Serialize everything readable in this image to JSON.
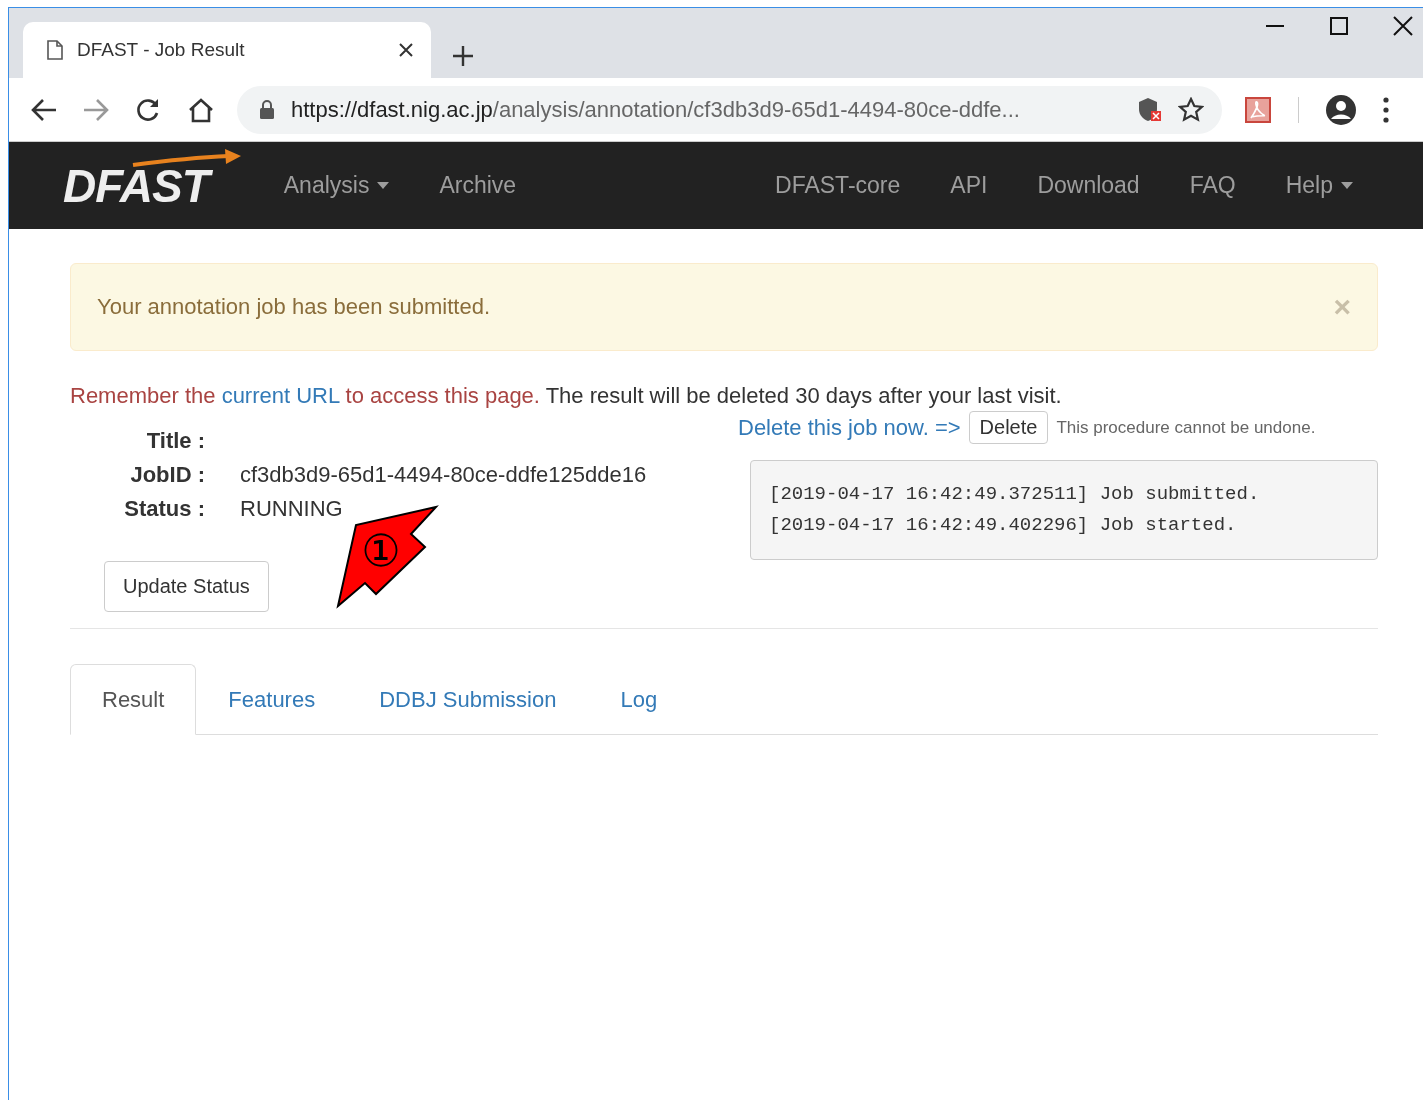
{
  "browser": {
    "tab_title": "DFAST - Job Result",
    "url_host": "https://dfast.nig.ac.jp",
    "url_path": "/analysis/annotation/cf3db3d9-65d1-4494-80ce-ddfe..."
  },
  "navbar": {
    "logo": "DFAST",
    "left_items": [
      {
        "label": "Analysis",
        "dropdown": true
      },
      {
        "label": "Archive",
        "dropdown": false
      }
    ],
    "right_items": [
      {
        "label": "DFAST-core",
        "dropdown": false
      },
      {
        "label": "API",
        "dropdown": false
      },
      {
        "label": "Download",
        "dropdown": false
      },
      {
        "label": "FAQ",
        "dropdown": false
      },
      {
        "label": "Help",
        "dropdown": true
      }
    ]
  },
  "alert": {
    "message": "Your annotation job has been submitted.",
    "close": "×"
  },
  "notice": {
    "before": "Remember the",
    "link": "current URL",
    "after": "to access this page.",
    "rest": "The result will be deleted 30 days after your last visit."
  },
  "delete": {
    "prompt": "Delete this job now. =>",
    "button": "Delete",
    "warning": "This procedure cannot be undone."
  },
  "job": [
    {
      "label": "Title :"
    },
    {
      "label": "JobID :",
      "value": "cf3db3d9-65d1-4494-80ce-ddfe125dde16"
    },
    {
      "label": "Status :",
      "value": "RUNNING"
    }
  ],
  "update_button": "Update Status",
  "log": [
    "[2019-04-17 16:42:49.372511] Job submitted.",
    "[2019-04-17 16:42:49.402296] Job started."
  ],
  "tabs": [
    {
      "label": "Result",
      "selected": true
    },
    {
      "label": "Features",
      "selected": false
    },
    {
      "label": "DDBJ Submission",
      "selected": false
    },
    {
      "label": "Log",
      "selected": false
    }
  ],
  "annotation": {
    "label": "①"
  }
}
